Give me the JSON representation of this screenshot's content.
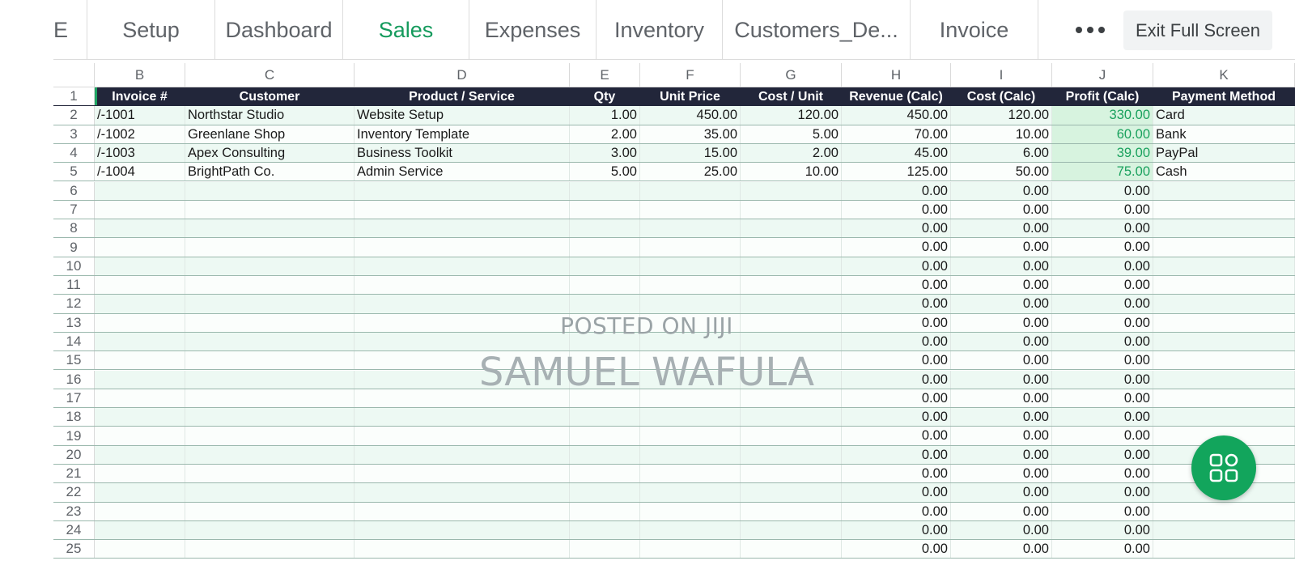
{
  "tabs": [
    {
      "label": "E",
      "active": false
    },
    {
      "label": "Setup",
      "active": false
    },
    {
      "label": "Dashboard",
      "active": false
    },
    {
      "label": "Sales",
      "active": true
    },
    {
      "label": "Expenses",
      "active": false
    },
    {
      "label": "Inventory",
      "active": false
    },
    {
      "label": "Customers_De...",
      "active": false
    },
    {
      "label": "Invoice",
      "active": false
    }
  ],
  "toolbar": {
    "more_icon": "more-horizontal-icon",
    "exit_label": "Exit Full Screen"
  },
  "grid": {
    "column_letters": [
      "B",
      "C",
      "D",
      "E",
      "F",
      "G",
      "H",
      "I",
      "J",
      "K"
    ],
    "header_row_number": "1",
    "headers": [
      "Invoice #",
      "Customer",
      "Product / Service",
      "Qty",
      "Unit Price",
      "Cost / Unit",
      "Revenue (Calc)",
      "Cost (Calc)",
      "Profit (Calc)",
      "Payment Method"
    ],
    "rows": [
      {
        "n": "2",
        "cells": [
          "/-1001",
          "Northstar Studio",
          "Website Setup",
          "1.00",
          "450.00",
          "120.00",
          "450.00",
          "120.00",
          "330.00",
          "Card"
        ]
      },
      {
        "n": "3",
        "cells": [
          "/-1002",
          "Greenlane Shop",
          "Inventory Template",
          "2.00",
          "35.00",
          "5.00",
          "70.00",
          "10.00",
          "60.00",
          "Bank"
        ]
      },
      {
        "n": "4",
        "cells": [
          "/-1003",
          "Apex Consulting",
          "Business Toolkit",
          "3.00",
          "15.00",
          "2.00",
          "45.00",
          "6.00",
          "39.00",
          "PayPal"
        ]
      },
      {
        "n": "5",
        "cells": [
          "/-1004",
          "BrightPath Co.",
          "Admin Service",
          "5.00",
          "25.00",
          "10.00",
          "125.00",
          "50.00",
          "75.00",
          "Cash"
        ]
      },
      {
        "n": "6",
        "cells": [
          "",
          "",
          "",
          "",
          "",
          "",
          "0.00",
          "0.00",
          "0.00",
          ""
        ]
      },
      {
        "n": "7",
        "cells": [
          "",
          "",
          "",
          "",
          "",
          "",
          "0.00",
          "0.00",
          "0.00",
          ""
        ]
      },
      {
        "n": "8",
        "cells": [
          "",
          "",
          "",
          "",
          "",
          "",
          "0.00",
          "0.00",
          "0.00",
          ""
        ]
      },
      {
        "n": "9",
        "cells": [
          "",
          "",
          "",
          "",
          "",
          "",
          "0.00",
          "0.00",
          "0.00",
          ""
        ]
      },
      {
        "n": "10",
        "cells": [
          "",
          "",
          "",
          "",
          "",
          "",
          "0.00",
          "0.00",
          "0.00",
          ""
        ]
      },
      {
        "n": "11",
        "cells": [
          "",
          "",
          "",
          "",
          "",
          "",
          "0.00",
          "0.00",
          "0.00",
          ""
        ]
      },
      {
        "n": "12",
        "cells": [
          "",
          "",
          "",
          "",
          "",
          "",
          "0.00",
          "0.00",
          "0.00",
          ""
        ]
      },
      {
        "n": "13",
        "cells": [
          "",
          "",
          "",
          "",
          "",
          "",
          "0.00",
          "0.00",
          "0.00",
          ""
        ]
      },
      {
        "n": "14",
        "cells": [
          "",
          "",
          "",
          "",
          "",
          "",
          "0.00",
          "0.00",
          "0.00",
          ""
        ]
      },
      {
        "n": "15",
        "cells": [
          "",
          "",
          "",
          "",
          "",
          "",
          "0.00",
          "0.00",
          "0.00",
          ""
        ]
      },
      {
        "n": "16",
        "cells": [
          "",
          "",
          "",
          "",
          "",
          "",
          "0.00",
          "0.00",
          "0.00",
          ""
        ]
      },
      {
        "n": "17",
        "cells": [
          "",
          "",
          "",
          "",
          "",
          "",
          "0.00",
          "0.00",
          "0.00",
          ""
        ]
      },
      {
        "n": "18",
        "cells": [
          "",
          "",
          "",
          "",
          "",
          "",
          "0.00",
          "0.00",
          "0.00",
          ""
        ]
      },
      {
        "n": "19",
        "cells": [
          "",
          "",
          "",
          "",
          "",
          "",
          "0.00",
          "0.00",
          "0.00",
          ""
        ]
      },
      {
        "n": "20",
        "cells": [
          "",
          "",
          "",
          "",
          "",
          "",
          "0.00",
          "0.00",
          "0.00",
          ""
        ]
      },
      {
        "n": "21",
        "cells": [
          "",
          "",
          "",
          "",
          "",
          "",
          "0.00",
          "0.00",
          "0.00",
          ""
        ]
      },
      {
        "n": "22",
        "cells": [
          "",
          "",
          "",
          "",
          "",
          "",
          "0.00",
          "0.00",
          "0.00",
          ""
        ]
      },
      {
        "n": "23",
        "cells": [
          "",
          "",
          "",
          "",
          "",
          "",
          "0.00",
          "0.00",
          "0.00",
          ""
        ]
      },
      {
        "n": "24",
        "cells": [
          "",
          "",
          "",
          "",
          "",
          "",
          "0.00",
          "0.00",
          "0.00",
          ""
        ]
      },
      {
        "n": "25",
        "cells": [
          "",
          "",
          "",
          "",
          "",
          "",
          "0.00",
          "0.00",
          "0.00",
          ""
        ]
      }
    ]
  },
  "watermark": {
    "line1": "POSTED ON JIJI",
    "line2": "SAMUEL WAFULA"
  },
  "fab": {
    "icon": "apps-grid-icon"
  },
  "colors": {
    "accent": "#149a5c",
    "header_bg": "#22263a",
    "profit_text": "#19a15d",
    "profit_bg": "#d7f3df",
    "row_band": "#edf9f3",
    "fab": "#12a55c"
  }
}
